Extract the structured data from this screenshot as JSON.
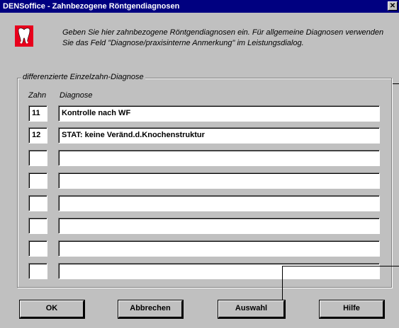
{
  "window": {
    "title": "DENSoffice - Zahnbezogene Röntgendiagnosen",
    "close_label": "✕"
  },
  "info": {
    "text": "Geben Sie hier zahnbezogene Röntgendiagnosen ein. Für allgemeine Diagnosen verwenden Sie das Feld \"Diagnose/praxisinterne Anmerkung\" im Leistungsdialog."
  },
  "group": {
    "title": "differenzierte Einzelzahn-Diagnose"
  },
  "columns": {
    "zahn": "Zahn",
    "diagnose": "Diagnose"
  },
  "rows": [
    {
      "zahn": "11",
      "diagnose": "Kontrolle nach WF"
    },
    {
      "zahn": "12",
      "diagnose": "STAT: keine Veränd.d.Knochenstruktur"
    },
    {
      "zahn": "",
      "diagnose": ""
    },
    {
      "zahn": "",
      "diagnose": ""
    },
    {
      "zahn": "",
      "diagnose": ""
    },
    {
      "zahn": "",
      "diagnose": ""
    },
    {
      "zahn": "",
      "diagnose": ""
    },
    {
      "zahn": "",
      "diagnose": ""
    }
  ],
  "buttons": {
    "ok": "OK",
    "cancel": "Abbrechen",
    "select": "Auswahl",
    "help": "Hilfe"
  },
  "colors": {
    "titlebar": "#000080",
    "dialog": "#c0c0c0",
    "icon_bg": "#e8001c"
  }
}
